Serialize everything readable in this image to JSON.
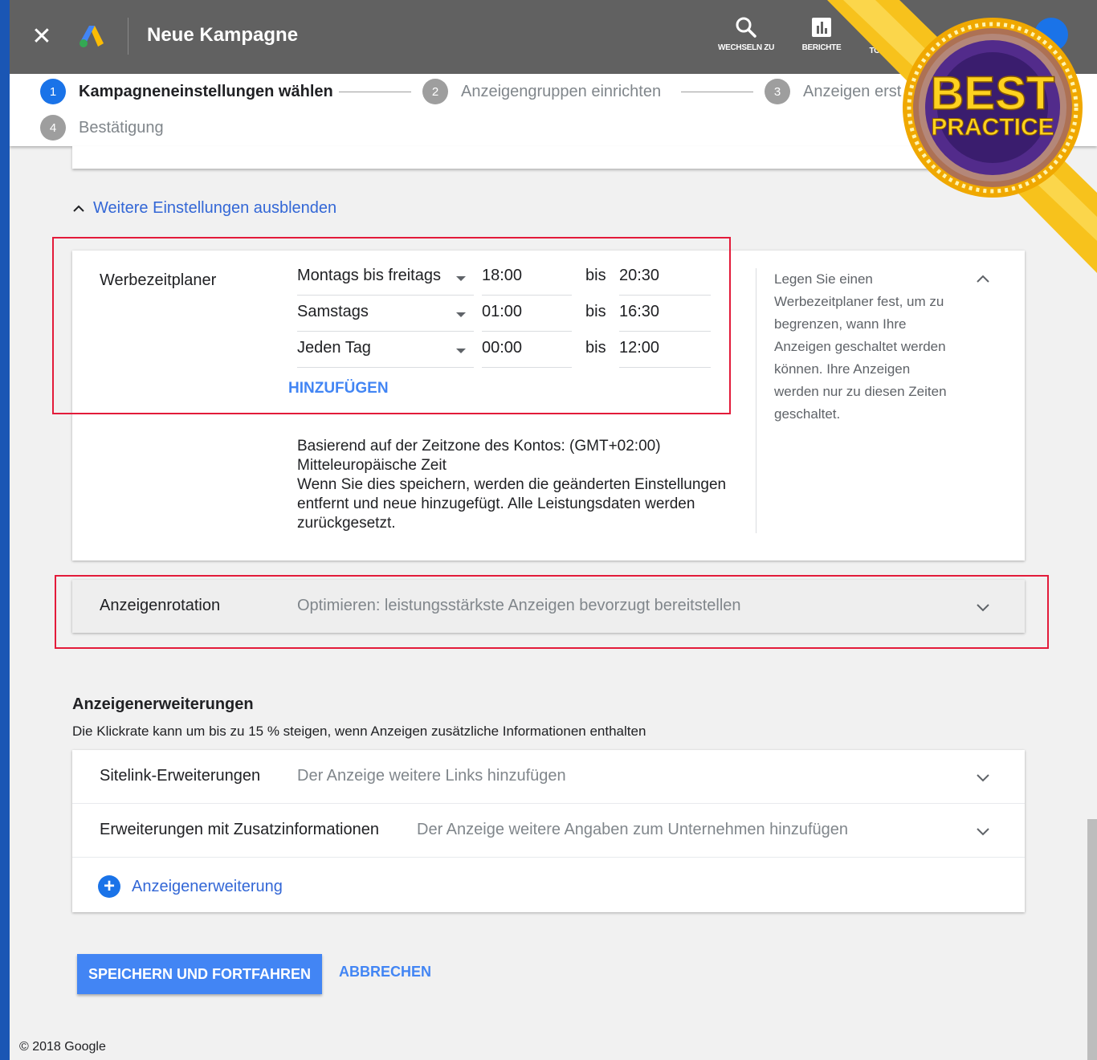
{
  "header": {
    "title": "Neue Kampagne",
    "tools": [
      {
        "icon": "search-icon",
        "label": "WECHSELN ZU"
      },
      {
        "icon": "reports-icon",
        "label": "BERICHTE"
      },
      {
        "icon": "tools-icon",
        "label": "TO"
      }
    ]
  },
  "stepper": {
    "steps": [
      {
        "number": "1",
        "label": "Kampagneneinstellungen wählen"
      },
      {
        "number": "2",
        "label": "Anzeigengruppen einrichten"
      },
      {
        "number": "3",
        "label": "Anzeigen erst"
      },
      {
        "number": "4",
        "label": "Bestätigung"
      }
    ]
  },
  "more_settings": {
    "label": "Weitere Einstellungen ausblenden"
  },
  "scheduler": {
    "title": "Werbezeitplaner",
    "rows": [
      {
        "days": "Montags bis freitags",
        "from": "18:00",
        "to_label": "bis",
        "to": "20:30"
      },
      {
        "days": "Samstags",
        "from": "01:00",
        "to_label": "bis",
        "to": "16:30"
      },
      {
        "days": "Jeden Tag",
        "from": "00:00",
        "to_label": "bis",
        "to": "12:00"
      }
    ],
    "add_label": "HINZUFÜGEN",
    "note_line1": "Basierend auf der Zeitzone des Kontos: (GMT+02:00)",
    "note_line2": "Mitteleuropäische Zeit",
    "note_line3": "Wenn Sie dies speichern, werden die geänderten Einstellungen entfernt und neue hinzugefügt. Alle Leistungsdaten werden zurückgesetzt.",
    "help": "Legen Sie einen Werbezeitplaner fest, um zu begrenzen, wann Ihre Anzeigen geschaltet werden können. Ihre Anzeigen werden nur zu diesen Zeiten geschaltet."
  },
  "rotation": {
    "label": "Anzeigenrotation",
    "value": "Optimieren: leistungsstärkste Anzeigen bevorzugt bereitstellen"
  },
  "extensions": {
    "title": "Anzeigenerweiterungen",
    "subtitle": "Die Klickrate kann um bis zu 15 % steigen, wenn Anzeigen zusätzliche Informationen enthalten",
    "rows": [
      {
        "label": "Sitelink-Erweiterungen",
        "value": "Der Anzeige weitere Links hinzufügen"
      },
      {
        "label": "Erweiterungen mit Zusatzinformationen",
        "value": "Der Anzeige weitere Angaben zum Unternehmen hinzufügen"
      }
    ],
    "add_label": "Anzeigenerweiterung"
  },
  "actions": {
    "save": "SPEICHERN UND FORTFAHREN",
    "cancel": "ABBRECHEN"
  },
  "footer": {
    "copyright": "© 2018 Google"
  },
  "badge": {
    "line1": "BEST",
    "line2": "PRACTICE"
  },
  "colors": {
    "accent": "#4285f4",
    "header": "#616161",
    "highlight": "#e31b3a",
    "badge_gold": "#f5b800"
  }
}
